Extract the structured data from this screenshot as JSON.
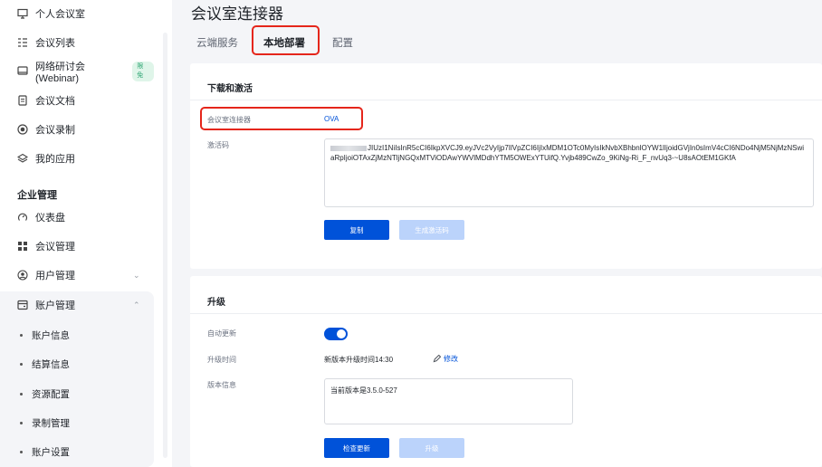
{
  "sidebar": {
    "items": [
      {
        "label": "个人会议室",
        "icon": "screen-icon"
      },
      {
        "label": "会议列表",
        "icon": "list-icon"
      },
      {
        "label": "网络研讨会(Webinar)",
        "icon": "monitor-icon",
        "badge": "限免"
      },
      {
        "label": "会议文档",
        "icon": "document-icon"
      },
      {
        "label": "会议录制",
        "icon": "record-icon"
      },
      {
        "label": "我的应用",
        "icon": "layers-icon"
      }
    ],
    "section": "企业管理",
    "admin_items": [
      {
        "label": "仪表盘",
        "icon": "gauge-icon"
      },
      {
        "label": "会议管理",
        "icon": "grid-icon"
      },
      {
        "label": "用户管理",
        "icon": "user-icon"
      },
      {
        "label": "账户管理",
        "icon": "account-icon"
      }
    ],
    "account_sub": [
      "账户信息",
      "结算信息",
      "资源配置",
      "录制管理",
      "账户设置"
    ]
  },
  "page": {
    "title": "会议室连接器",
    "tabs": [
      "云端服务",
      "本地部署",
      "配置"
    ],
    "active_tab": "本地部署"
  },
  "download": {
    "title": "下载和激活",
    "connector_label": "会议室连接器",
    "connector_value": "OVA",
    "activation_label": "激活码",
    "activation_code": "JIUzI1NiIsInR5cCI6IkpXVCJ9.eyJVc2VyIjp7IlVpZCI6IjIxMDM1OTc0MyIsIkNvbXBhbnlOYW1lIjoidGVjIn0sImV4cCI6NDo4NjM5NjMzNSwiaRpIjoiOTAxZjMzNTljNGQxMTViODAwYWVlMDdhYTM5OWExYTUifQ.Yvjb489CwZo_9KiNg-Ri_F_nvUq3-~U8sAOtEM1GKfA",
    "copy_button": "复制",
    "generate_button": "生成激活码"
  },
  "upgrade": {
    "title": "升级",
    "auto_update_label": "自动更新",
    "auto_update_on": true,
    "time_label": "升级时间",
    "time_value": "新版本升级时间14:30",
    "edit_link": "修改",
    "version_label": "版本信息",
    "version_value": "当前版本是3.5.0-527",
    "check_button": "检查更新",
    "upgrade_button": "升级"
  },
  "colors": {
    "primary": "#0052d9",
    "primary_disabled": "#bbd3fb",
    "highlight": "#e5261b",
    "badge_text": "#2ba471"
  }
}
